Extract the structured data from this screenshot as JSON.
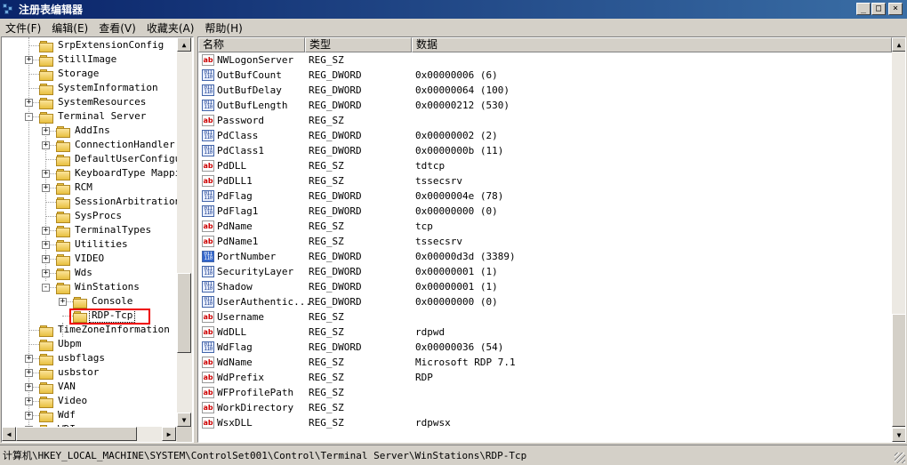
{
  "window": {
    "title": "注册表编辑器",
    "minimize": "_",
    "maximize": "□",
    "close": "×"
  },
  "menu": [
    "文件(F)",
    "编辑(E)",
    "查看(V)",
    "收藏夹(A)",
    "帮助(H)"
  ],
  "tree": [
    {
      "label": "SrpExtensionConfig",
      "level": 1,
      "expander": "none"
    },
    {
      "label": "StillImage",
      "level": 1,
      "expander": "+"
    },
    {
      "label": "Storage",
      "level": 1,
      "expander": "none"
    },
    {
      "label": "SystemInformation",
      "level": 1,
      "expander": "none"
    },
    {
      "label": "SystemResources",
      "level": 1,
      "expander": "+"
    },
    {
      "label": "Terminal Server",
      "level": 1,
      "expander": "-"
    },
    {
      "label": "AddIns",
      "level": 2,
      "expander": "+"
    },
    {
      "label": "ConnectionHandler",
      "level": 2,
      "expander": "+"
    },
    {
      "label": "DefaultUserConfigur",
      "level": 2,
      "expander": "none"
    },
    {
      "label": "KeyboardType Mappin",
      "level": 2,
      "expander": "+"
    },
    {
      "label": "RCM",
      "level": 2,
      "expander": "+"
    },
    {
      "label": "SessionArbitrationH",
      "level": 2,
      "expander": "none"
    },
    {
      "label": "SysProcs",
      "level": 2,
      "expander": "none"
    },
    {
      "label": "TerminalTypes",
      "level": 2,
      "expander": "+"
    },
    {
      "label": "Utilities",
      "level": 2,
      "expander": "+"
    },
    {
      "label": "VIDEO",
      "level": 2,
      "expander": "+"
    },
    {
      "label": "Wds",
      "level": 2,
      "expander": "+"
    },
    {
      "label": "WinStations",
      "level": 2,
      "expander": "-"
    },
    {
      "label": "Console",
      "level": 3,
      "expander": "+"
    },
    {
      "label": "RDP-Tcp",
      "level": 3,
      "expander": "none",
      "selected": true
    },
    {
      "label": "TimeZoneInformation",
      "level": 1,
      "expander": "none"
    },
    {
      "label": "Ubpm",
      "level": 1,
      "expander": "none"
    },
    {
      "label": "usbflags",
      "level": 1,
      "expander": "+"
    },
    {
      "label": "usbstor",
      "level": 1,
      "expander": "+"
    },
    {
      "label": "VAN",
      "level": 1,
      "expander": "+"
    },
    {
      "label": "Video",
      "level": 1,
      "expander": "+"
    },
    {
      "label": "Wdf",
      "level": 1,
      "expander": "+"
    },
    {
      "label": "WDI",
      "level": 1,
      "expander": "+"
    }
  ],
  "columns": {
    "name": "名称",
    "type": "类型",
    "data": "数据"
  },
  "values": [
    {
      "name": "NWLogonServer",
      "type": "REG_SZ",
      "data": "",
      "icon": "string-value-icon"
    },
    {
      "name": "OutBufCount",
      "type": "REG_DWORD",
      "data": "0x00000006 (6)",
      "icon": "dword-value-icon"
    },
    {
      "name": "OutBufDelay",
      "type": "REG_DWORD",
      "data": "0x00000064 (100)",
      "icon": "dword-value-icon"
    },
    {
      "name": "OutBufLength",
      "type": "REG_DWORD",
      "data": "0x00000212 (530)",
      "icon": "dword-value-icon"
    },
    {
      "name": "Password",
      "type": "REG_SZ",
      "data": "",
      "icon": "string-value-icon"
    },
    {
      "name": "PdClass",
      "type": "REG_DWORD",
      "data": "0x00000002 (2)",
      "icon": "dword-value-icon"
    },
    {
      "name": "PdClass1",
      "type": "REG_DWORD",
      "data": "0x0000000b (11)",
      "icon": "dword-value-icon"
    },
    {
      "name": "PdDLL",
      "type": "REG_SZ",
      "data": "tdtcp",
      "icon": "string-value-icon"
    },
    {
      "name": "PdDLL1",
      "type": "REG_SZ",
      "data": "tssecsrv",
      "icon": "string-value-icon"
    },
    {
      "name": "PdFlag",
      "type": "REG_DWORD",
      "data": "0x0000004e (78)",
      "icon": "dword-value-icon"
    },
    {
      "name": "PdFlag1",
      "type": "REG_DWORD",
      "data": "0x00000000 (0)",
      "icon": "dword-value-icon"
    },
    {
      "name": "PdName",
      "type": "REG_SZ",
      "data": "tcp",
      "icon": "string-value-icon"
    },
    {
      "name": "PdName1",
      "type": "REG_SZ",
      "data": "tssecsrv",
      "icon": "string-value-icon"
    },
    {
      "name": "PortNumber",
      "type": "REG_DWORD",
      "data": "0x00000d3d (3389)",
      "icon": "dword-value-icon",
      "selected": true
    },
    {
      "name": "SecurityLayer",
      "type": "REG_DWORD",
      "data": "0x00000001 (1)",
      "icon": "dword-value-icon"
    },
    {
      "name": "Shadow",
      "type": "REG_DWORD",
      "data": "0x00000001 (1)",
      "icon": "dword-value-icon"
    },
    {
      "name": "UserAuthentic...",
      "type": "REG_DWORD",
      "data": "0x00000000 (0)",
      "icon": "dword-value-icon"
    },
    {
      "name": "Username",
      "type": "REG_SZ",
      "data": "",
      "icon": "string-value-icon"
    },
    {
      "name": "WdDLL",
      "type": "REG_SZ",
      "data": "rdpwd",
      "icon": "string-value-icon"
    },
    {
      "name": "WdFlag",
      "type": "REG_DWORD",
      "data": "0x00000036 (54)",
      "icon": "dword-value-icon"
    },
    {
      "name": "WdName",
      "type": "REG_SZ",
      "data": "Microsoft RDP 7.1",
      "icon": "string-value-icon"
    },
    {
      "name": "WdPrefix",
      "type": "REG_SZ",
      "data": "RDP",
      "icon": "string-value-icon"
    },
    {
      "name": "WFProfilePath",
      "type": "REG_SZ",
      "data": "",
      "icon": "string-value-icon"
    },
    {
      "name": "WorkDirectory",
      "type": "REG_SZ",
      "data": "",
      "icon": "string-value-icon"
    },
    {
      "name": "WsxDLL",
      "type": "REG_SZ",
      "data": "rdpwsx",
      "icon": "string-value-icon"
    }
  ],
  "icon_text": {
    "string": "ab",
    "dword": "011\n110"
  },
  "scroll_arrows": {
    "up": "▲",
    "down": "▼",
    "left": "◀",
    "right": "▶"
  },
  "status_path": "计算机\\HKEY_LOCAL_MACHINE\\SYSTEM\\ControlSet001\\Control\\Terminal Server\\WinStations\\RDP-Tcp",
  "colors": {
    "titlebar": "#0a246a",
    "highlight_box": "#ee0000"
  }
}
